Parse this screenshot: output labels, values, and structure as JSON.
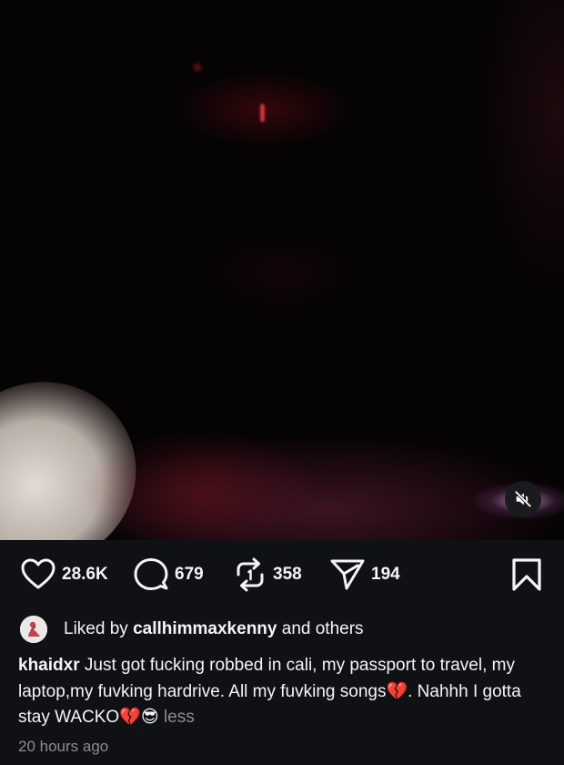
{
  "media": {
    "mute_icon": "speaker-muted-icon"
  },
  "actions": {
    "like": {
      "icon": "heart-icon",
      "count": "28.6K"
    },
    "comment": {
      "icon": "comment-bubble-icon",
      "count": "679"
    },
    "repost": {
      "icon": "repost-icon",
      "count": "358"
    },
    "share": {
      "icon": "send-icon",
      "count": "194"
    },
    "save": {
      "icon": "bookmark-icon"
    }
  },
  "liked_by": {
    "prefix": "Liked by",
    "user": "callhimmaxkenny",
    "suffix": "and others"
  },
  "caption": {
    "username": "khaidxr",
    "text": "Just got fucking robbed in cali, my passport to travel, my laptop,my fuvking hardrive. All my fuvking songs💔. Nahhh I gotta stay WACKO💔😎",
    "less_label": "less"
  },
  "timestamp": "20 hours ago",
  "colors": {
    "background": "#101114",
    "text": "#f3f5f7",
    "muted_text": "#8a8d93"
  }
}
